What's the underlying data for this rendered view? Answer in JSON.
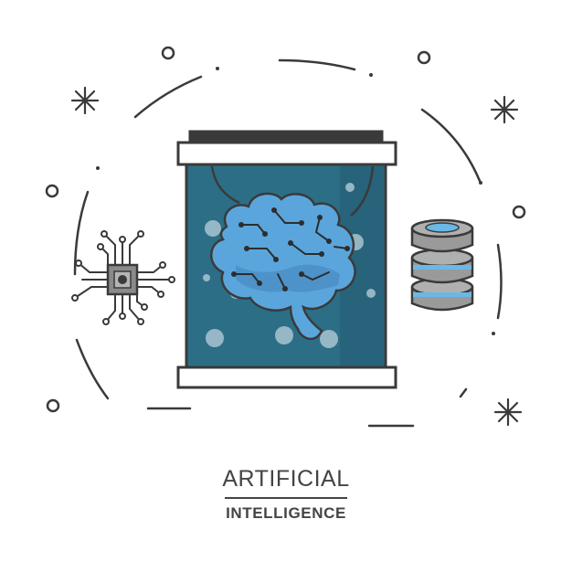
{
  "title": {
    "line1": "ARTIFICIAL",
    "line2": "INTELLIGENCE"
  },
  "colors": {
    "background": "#ffffff",
    "stroke": "#3a3a3a",
    "tank_fluid": "#2c6e86",
    "brain": "#5aa6dc",
    "brain_shade": "#4a8fc4",
    "bubble": "#a9c4d2",
    "chip": "#8a8a8a",
    "disk": "#9a9a9a",
    "disk_band": "#69b8e6"
  },
  "icons": [
    "brain-icon",
    "specimen-tank-icon",
    "microchip-icon",
    "database-icon",
    "sparkle-icon",
    "ring-icon"
  ]
}
